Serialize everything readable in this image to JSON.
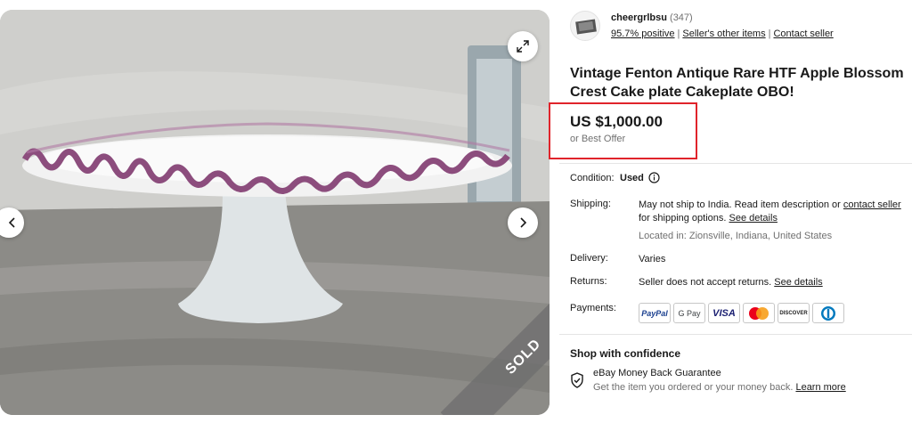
{
  "gallery": {
    "image_alt": "Cake stand photo",
    "sold_label": "SOLD",
    "expand_icon": "expand-icon",
    "prev_icon": "chevron-left-icon",
    "next_icon": "chevron-right-icon"
  },
  "seller": {
    "name": "cheergrlbsu",
    "feedback_count": "(347)",
    "positive": "95.7% positive",
    "other_items": "Seller's other items",
    "contact": "Contact seller"
  },
  "listing": {
    "title": "Vintage Fenton Antique Rare HTF Apple Blossom Crest Cake plate Cakeplate OBO!",
    "price": "US $1,000.00",
    "best_offer": "or Best Offer",
    "highlight_color": "#e0242b"
  },
  "details": {
    "condition_label": "Condition:",
    "condition_value": "Used",
    "shipping_label": "Shipping:",
    "shipping_text1": "May not ship to India. Read item description or ",
    "shipping_link1": "contact seller",
    "shipping_text2": " for shipping options. ",
    "shipping_link2": "See details",
    "location": "Located in: Zionsville, Indiana, United States",
    "delivery_label": "Delivery:",
    "delivery_value": "Varies",
    "returns_label": "Returns:",
    "returns_text": "Seller does not accept returns. ",
    "returns_link": "See details",
    "payments_label": "Payments:",
    "payment_methods": [
      "PayPal",
      "G Pay",
      "VISA",
      "Mastercard",
      "DISCOVER",
      "Diners Club"
    ]
  },
  "confidence": {
    "heading": "Shop with confidence",
    "guarantee_title": "eBay Money Back Guarantee",
    "guarantee_desc": "Get the item you ordered or your money back. ",
    "learn_more": "Learn more"
  }
}
